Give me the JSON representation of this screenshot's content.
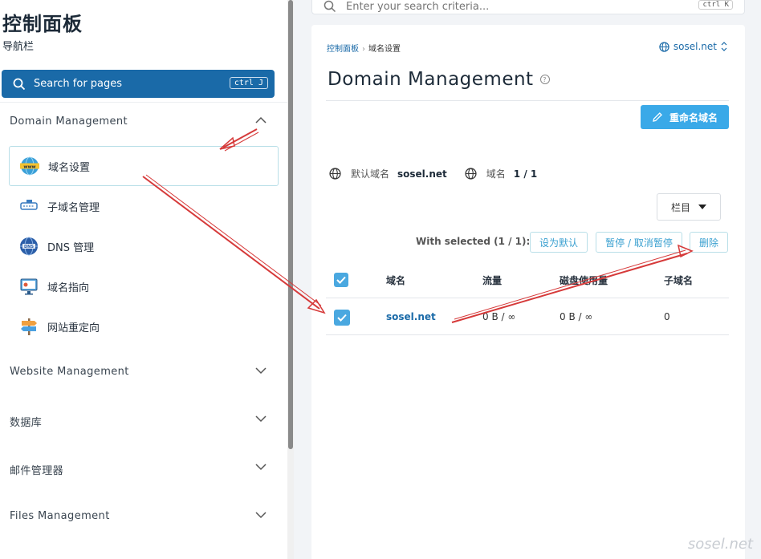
{
  "sidebar": {
    "title": "控制面板",
    "subtitle": "导航栏",
    "search_label": "Search for pages",
    "search_shortcut": "ctrl J",
    "sections": [
      {
        "label": "Domain Management",
        "expanded": true
      },
      {
        "label": "Website Management",
        "expanded": false
      },
      {
        "label": "数据库",
        "expanded": false
      },
      {
        "label": "邮件管理器",
        "expanded": false
      },
      {
        "label": "Files Management",
        "expanded": false
      }
    ],
    "items": [
      {
        "label": "域名设置",
        "icon": "www-globe-icon",
        "active": true
      },
      {
        "label": "子域名管理",
        "icon": "subdomain-icon",
        "active": false
      },
      {
        "label": "DNS 管理",
        "icon": "dns-globe-icon",
        "active": false
      },
      {
        "label": "域名指向",
        "icon": "monitor-icon",
        "active": false
      },
      {
        "label": "网站重定向",
        "icon": "signpost-icon",
        "active": false
      }
    ]
  },
  "top_search": {
    "placeholder": "Enter your search criteria...",
    "shortcut": "ctrl K"
  },
  "breadcrumb": {
    "root": "控制面板",
    "current": "域名设置"
  },
  "domain_selector": "sosel.net",
  "page_title": "Domain Management",
  "rename_button": "重命名域名",
  "info": {
    "default_label": "默认域名",
    "default_value": "sosel.net",
    "count_label": "域名",
    "count_value": "1 / 1"
  },
  "columns_button": "栏目",
  "selection": {
    "label": "With selected (1 / 1):",
    "actions": [
      "设为默认",
      "暂停 / 取消暂停",
      "删除"
    ]
  },
  "table": {
    "headers": [
      "域名",
      "流量",
      "磁盘使用量",
      "子域名"
    ],
    "rows": [
      {
        "domain": "sosel.net",
        "traffic": "0 B / ∞",
        "disk": "0 B / ∞",
        "subdomains": "0",
        "checked": true
      }
    ]
  },
  "watermark": "sosel.net",
  "colors": {
    "primary": "#1a6aa8",
    "accent": "#3aa9e8",
    "annotation": "#d63a3a"
  }
}
